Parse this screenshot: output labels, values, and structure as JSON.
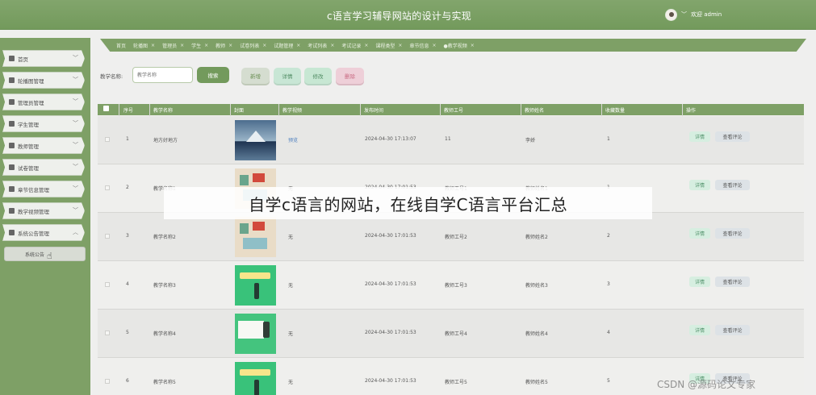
{
  "header": {
    "title": "c语言学习辅导网站的设计与实现",
    "user": "欢迎 admin",
    "user_arrow": "﹀"
  },
  "sidebar": {
    "items": [
      {
        "label": "首页",
        "icon": "home-icon"
      },
      {
        "label": "轮播图管理",
        "icon": "chart-icon"
      },
      {
        "label": "管理员管理",
        "icon": "admin-icon"
      },
      {
        "label": "学生管理",
        "icon": "user-icon"
      },
      {
        "label": "教师管理",
        "icon": "teacher-icon"
      },
      {
        "label": "试卷管理",
        "icon": "paper-icon"
      },
      {
        "label": "章节信息管理",
        "icon": "chapter-icon"
      },
      {
        "label": "教学视频管理",
        "icon": "video-icon"
      },
      {
        "label": "系统公告管理",
        "icon": "notice-icon"
      }
    ],
    "submenu_item": "系统公告",
    "chevron": "﹀",
    "chevron_up": "︿"
  },
  "tabs": [
    "首页",
    "轮播图",
    "管理员",
    "学生",
    "教师",
    "试卷列表",
    "试题管理",
    "考试列表",
    "考试记录",
    "课程类型",
    "章节信息",
    "●教学视频"
  ],
  "tab_close": "×",
  "search": {
    "label": "教学名称:",
    "placeholder": "教学名称",
    "button": "搜索"
  },
  "actions": {
    "add": "新增",
    "detail": "详情",
    "edit": "修改",
    "delete": "删除"
  },
  "table": {
    "headers": [
      "序号",
      "教学名称",
      "封面",
      "教学视频",
      "发布时间",
      "教师工号",
      "教师姓名",
      "收藏数量",
      "操作"
    ],
    "rows": [
      {
        "no": "1",
        "name": "地方好地方",
        "video": "预览",
        "time": "2024-04-30 17:13:07",
        "teacher_id": "11",
        "teacher_name": "李娇",
        "favorites": "1",
        "cover": "lake"
      },
      {
        "no": "2",
        "name": "教学名称1",
        "video": "无",
        "time": "2024-04-30 17:01:53",
        "teacher_id": "教师工号1",
        "teacher_name": "教师姓名1",
        "favorites": "1",
        "cover": "room"
      },
      {
        "no": "3",
        "name": "教学名称2",
        "video": "无",
        "time": "2024-04-30 17:01:53",
        "teacher_id": "教师工号2",
        "teacher_name": "教师姓名2",
        "favorites": "2",
        "cover": "room"
      },
      {
        "no": "4",
        "name": "教学名称3",
        "video": "无",
        "time": "2024-04-30 17:01:53",
        "teacher_id": "教师工号3",
        "teacher_name": "教师姓名3",
        "favorites": "3",
        "cover": "green"
      },
      {
        "no": "5",
        "name": "教学名称4",
        "video": "无",
        "time": "2024-04-30 17:01:53",
        "teacher_id": "教师工号4",
        "teacher_name": "教师姓名4",
        "favorites": "4",
        "cover": "desk"
      },
      {
        "no": "6",
        "name": "教学名称5",
        "video": "无",
        "time": "2024-04-30 17:01:53",
        "teacher_id": "教师工号5",
        "teacher_name": "教师姓名5",
        "favorites": "5",
        "cover": "green"
      }
    ],
    "row_actions": {
      "detail": "详情",
      "review": "查看评论"
    }
  },
  "overlay": {
    "caption": "自学c语言的网站，在线自学C语言平台汇总"
  },
  "watermark": "CSDN @源码论文专家",
  "colors": {
    "primary": "#7ea066",
    "header": "#739a5c",
    "background": "#efefee",
    "delete": "#c96a82"
  }
}
